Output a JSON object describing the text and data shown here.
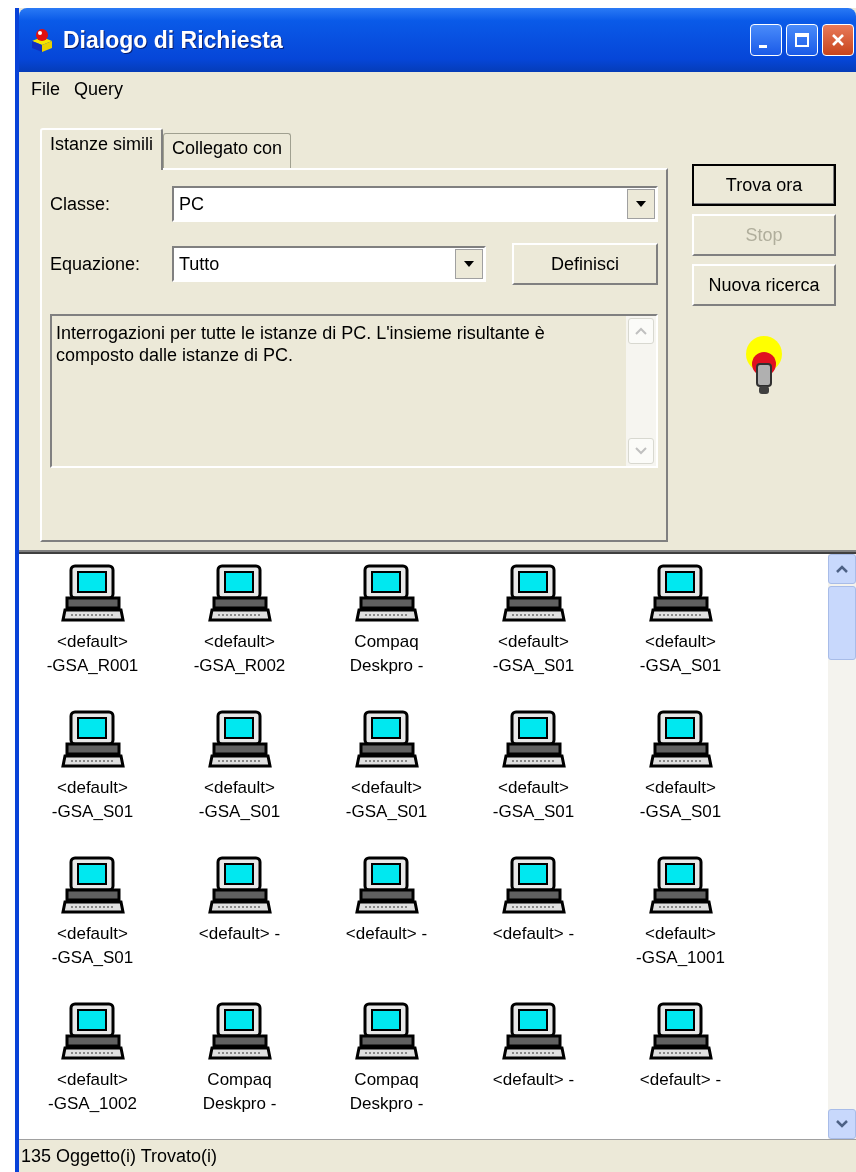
{
  "window": {
    "title": "Dialogo di Richiesta"
  },
  "menu": [
    "File",
    "Query"
  ],
  "tabs": [
    {
      "label": "Istanze simili",
      "selected": true
    },
    {
      "label": "Collegato con",
      "selected": false
    }
  ],
  "class_field": {
    "label": "Classe:",
    "value": "PC"
  },
  "equation_field": {
    "label": "Equazione:",
    "value": "Tutto"
  },
  "define_button": {
    "label": "Definisci",
    "disabled": false
  },
  "description": "Interrogazioni per tutte le istanze di PC. L'insieme risultante è composto dalle istanze di PC.",
  "side_buttons": [
    {
      "label": "Trova ora",
      "disabled": false,
      "default": true
    },
    {
      "label": "Stop",
      "disabled": true,
      "default": false
    },
    {
      "label": "Nuova ricerca",
      "disabled": false,
      "default": false
    }
  ],
  "results": [
    {
      "label": "<default>\n-GSA_R001"
    },
    {
      "label": "<default>\n-GSA_R002"
    },
    {
      "label": "Compaq\nDeskpro -"
    },
    {
      "label": "<default>\n-GSA_S01"
    },
    {
      "label": "<default>\n-GSA_S01"
    },
    {
      "label": "<default>\n-GSA_S01"
    },
    {
      "label": "<default>\n-GSA_S01"
    },
    {
      "label": "<default>\n-GSA_S01"
    },
    {
      "label": "<default>\n-GSA_S01"
    },
    {
      "label": "<default>\n-GSA_S01"
    },
    {
      "label": "<default>\n-GSA_S01"
    },
    {
      "label": "<default> -"
    },
    {
      "label": "<default> -"
    },
    {
      "label": "<default> -"
    },
    {
      "label": "<default>\n-GSA_1001"
    },
    {
      "label": "<default>\n-GSA_1002"
    },
    {
      "label": "Compaq\nDeskpro -"
    },
    {
      "label": "Compaq\nDeskpro -"
    },
    {
      "label": "<default> -"
    },
    {
      "label": "<default> -"
    }
  ],
  "status_bar": "135 Oggetto(i) Trovato(i)"
}
